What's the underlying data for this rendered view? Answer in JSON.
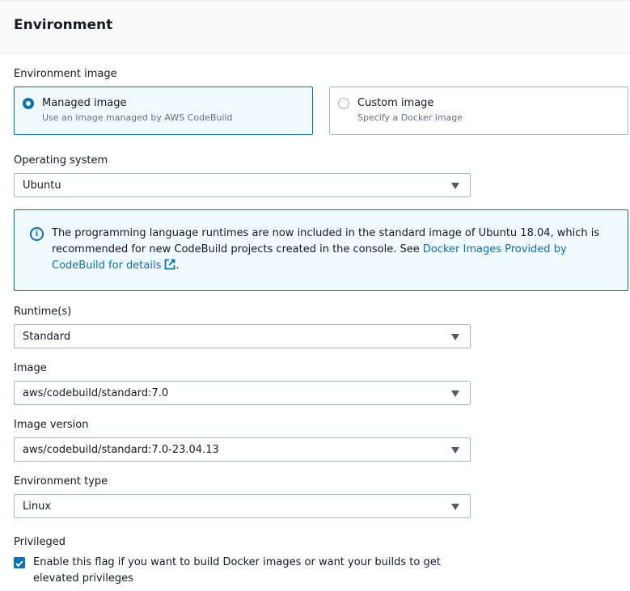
{
  "header": {
    "title": "Environment"
  },
  "environment_image": {
    "label": "Environment image",
    "options": [
      {
        "title": "Managed image",
        "description": "Use an image managed by AWS CodeBuild",
        "selected": true
      },
      {
        "title": "Custom image",
        "description": "Specify a Docker image",
        "selected": false
      }
    ]
  },
  "operating_system": {
    "label": "Operating system",
    "value": "Ubuntu"
  },
  "info": {
    "text": "The programming language runtimes are now included in the standard image of Ubuntu 18.04, which is recommended for new CodeBuild projects created in the console. See ",
    "link_text": "Docker Images Provided by CodeBuild for details",
    "trailing": ".",
    "icon": "info-icon",
    "link_icon": "external-link-icon"
  },
  "runtimes": {
    "label": "Runtime(s)",
    "value": "Standard"
  },
  "image": {
    "label": "Image",
    "value": "aws/codebuild/standard:7.0"
  },
  "image_version": {
    "label": "Image version",
    "value": "aws/codebuild/standard:7.0-23.04.13"
  },
  "environment_type": {
    "label": "Environment type",
    "value": "Linux"
  },
  "privileged": {
    "label": "Privileged",
    "checkbox_label": "Enable this flag if you want to build Docker images or want your builds to get elevated privileges",
    "checked": true
  },
  "colors": {
    "accent": "#0073bb",
    "border": "#aab7b8",
    "header_bg": "#fafafa",
    "info_bg": "#f1faff"
  }
}
